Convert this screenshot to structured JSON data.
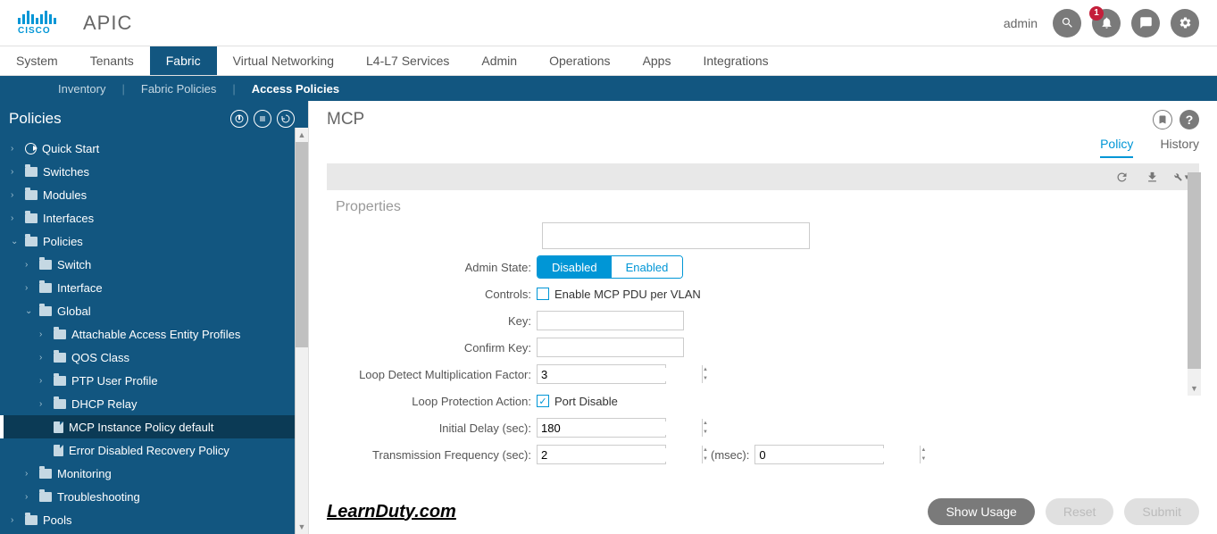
{
  "brand": {
    "logo_text": "CISCO",
    "app_title": "APIC"
  },
  "header": {
    "username": "admin",
    "notif_count": "1"
  },
  "nav_primary": [
    "System",
    "Tenants",
    "Fabric",
    "Virtual Networking",
    "L4-L7 Services",
    "Admin",
    "Operations",
    "Apps",
    "Integrations"
  ],
  "nav_primary_active": "Fabric",
  "nav_secondary": [
    "Inventory",
    "Fabric Policies",
    "Access Policies"
  ],
  "nav_secondary_active": "Access Policies",
  "sidebar": {
    "title": "Policies",
    "items": {
      "quick_start": "Quick Start",
      "switches": "Switches",
      "modules": "Modules",
      "interfaces": "Interfaces",
      "policies": "Policies",
      "switch": "Switch",
      "interface": "Interface",
      "global": "Global",
      "aaep": "Attachable Access Entity Profiles",
      "qos": "QOS Class",
      "ptp": "PTP User Profile",
      "dhcp": "DHCP Relay",
      "mcp": "MCP Instance Policy default",
      "errdis": "Error Disabled Recovery Policy",
      "monitoring": "Monitoring",
      "troubleshooting": "Troubleshooting",
      "pools": "Pools"
    }
  },
  "content": {
    "title": "MCP",
    "tabs": [
      "Policy",
      "History"
    ],
    "active_tab": "Policy",
    "section": "Properties",
    "labels": {
      "admin_state": "Admin State:",
      "controls": "Controls:",
      "key": "Key:",
      "confirm_key": "Confirm Key:",
      "loop_mult": "Loop Detect Multiplication Factor:",
      "loop_action": "Loop Protection Action:",
      "initial_delay": "Initial Delay (sec):",
      "tx_freq": "Transmission Frequency (sec):",
      "msec": "(msec):"
    },
    "toggle": {
      "disabled": "Disabled",
      "enabled": "Enabled"
    },
    "controls_cb": "Enable MCP PDU per VLAN",
    "loop_action_cb": "Port Disable",
    "values": {
      "loop_mult": "3",
      "initial_delay": "180",
      "tx_freq_sec": "2",
      "tx_freq_msec": "0"
    },
    "buttons": {
      "show_usage": "Show Usage",
      "reset": "Reset",
      "submit": "Submit"
    },
    "watermark": "LearnDuty.com"
  }
}
